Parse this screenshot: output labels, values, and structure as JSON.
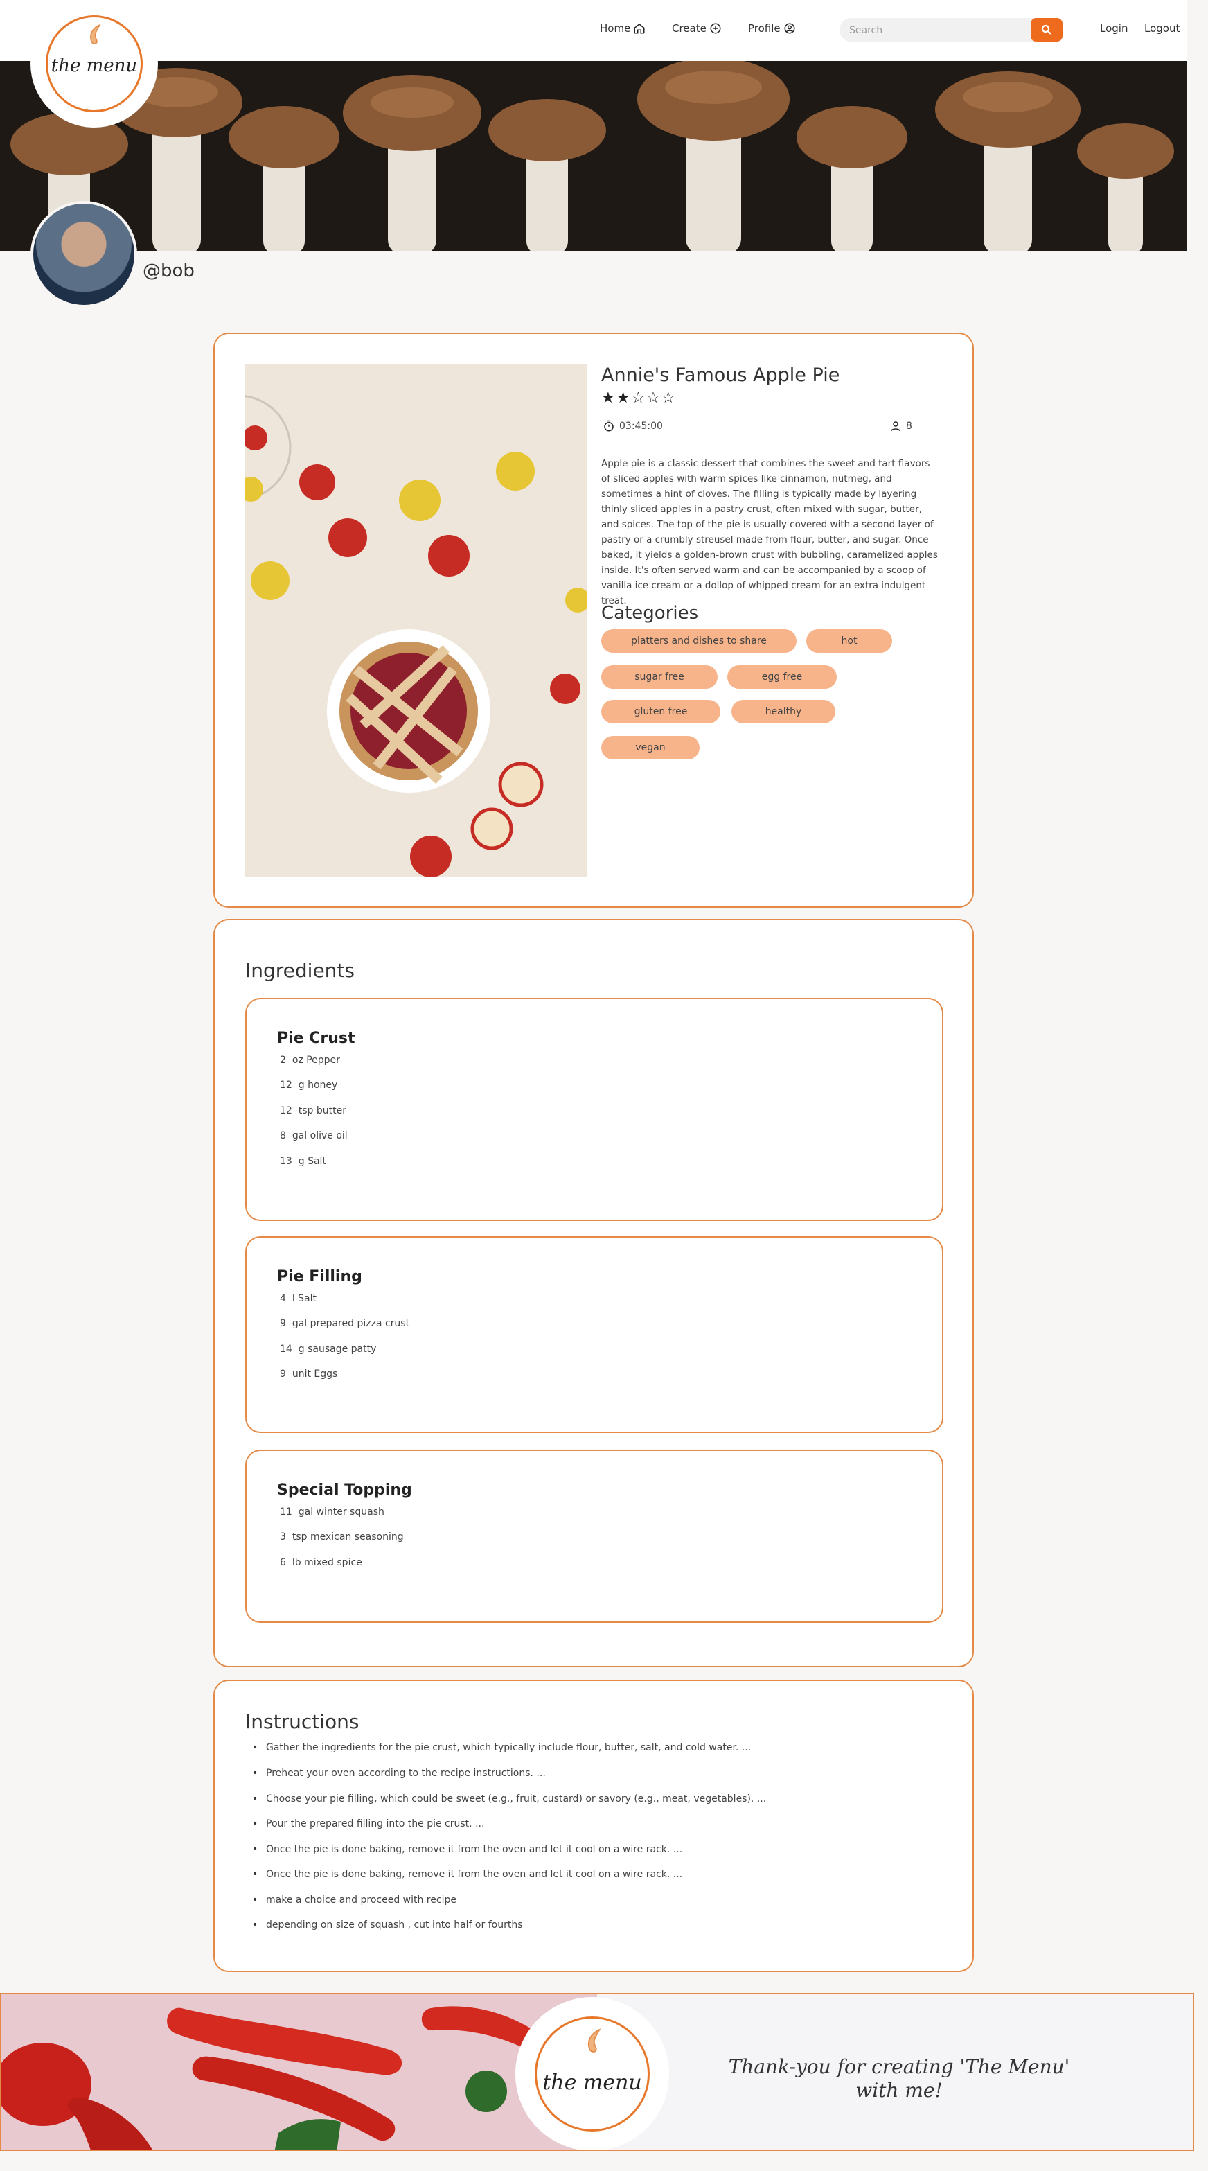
{
  "brand": {
    "logo_text": "the menu"
  },
  "nav": {
    "home": "Home",
    "create": "Create",
    "profile": "Profile",
    "search_placeholder": "Search",
    "login": "Login",
    "logout": "Logout"
  },
  "profile": {
    "username": "@bob"
  },
  "recipe": {
    "title": "Annie's Famous Apple Pie",
    "rating": 2,
    "rating_max": 5,
    "stars_display": "★★☆☆☆",
    "time": "03:45:00",
    "servings": "8",
    "description": "Apple pie is a classic dessert that combines the sweet and tart flavors of sliced apples with warm spices like cinnamon, nutmeg, and sometimes a hint of cloves. The filling is typically made by layering thinly sliced apples in a pastry crust, often mixed with sugar, butter, and spices. The top of the pie is usually covered with a second layer of pastry or a crumbly streusel made from flour, butter, and sugar. Once baked, it yields a golden-brown crust with bubbling, caramelized apples inside. It's often served warm and can be accompanied by a scoop of vanilla ice cream or a dollop of whipped cream for an extra indulgent treat.",
    "categories_title": "Categories",
    "categories": [
      "platters and dishes to share",
      "hot",
      "sugar free",
      "egg free",
      "gluten free",
      "healthy",
      "vegan"
    ]
  },
  "ingredients": {
    "title": "Ingredients",
    "groups": [
      {
        "name": "Pie Crust",
        "items": [
          {
            "qty": "2",
            "text": "oz Pepper"
          },
          {
            "qty": "12",
            "text": "g honey"
          },
          {
            "qty": "12",
            "text": "tsp butter"
          },
          {
            "qty": "8",
            "text": "gal olive oil"
          },
          {
            "qty": "13",
            "text": "g Salt"
          }
        ]
      },
      {
        "name": "Pie Filling",
        "items": [
          {
            "qty": "4",
            "text": "l Salt"
          },
          {
            "qty": "9",
            "text": "gal prepared pizza crust"
          },
          {
            "qty": "14",
            "text": "g sausage patty"
          },
          {
            "qty": "9",
            "text": "unit Eggs"
          }
        ]
      },
      {
        "name": "Special Topping",
        "items": [
          {
            "qty": "11",
            "text": "gal winter squash"
          },
          {
            "qty": "3",
            "text": "tsp mexican seasoning"
          },
          {
            "qty": "6",
            "text": "lb mixed spice"
          }
        ]
      }
    ]
  },
  "instructions": {
    "title": "Instructions",
    "steps": [
      "Gather the ingredients for the pie crust, which typically include flour, butter, salt, and cold water. ...",
      "Preheat your oven according to the recipe instructions. ...",
      "Choose your pie filling, which could be sweet (e.g., fruit, custard) or savory (e.g., meat, vegetables). ...",
      "Pour the prepared filling into the pie crust. ...",
      "Once the pie is done baking, remove it from the oven and let it cool on a wire rack. ...",
      "Once the pie is done baking, remove it from the oven and let it cool on a wire rack. ...",
      "make a choice and proceed with recipe",
      "depending on size of squash , cut into half or fourths"
    ]
  },
  "footer": {
    "thanks_line1": "Thank-you for creating 'The Menu'",
    "thanks_line2": "with me!"
  },
  "colors": {
    "accent": "#ee6a1c",
    "border": "#e48a46",
    "chip": "#f7b48b"
  },
  "icons": [
    "home-icon",
    "plus-circle-icon",
    "user-circle-icon",
    "search-icon",
    "timer-icon",
    "person-icon"
  ]
}
